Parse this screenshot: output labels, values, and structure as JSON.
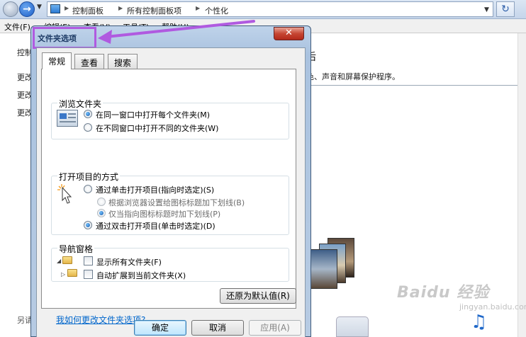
{
  "explorer": {
    "breadcrumbs": [
      "控制面板",
      "所有控制面板项",
      "个性化"
    ],
    "menu": [
      "文件(F)",
      "编辑(E)",
      "查看(V)",
      "工具(T)",
      "帮助(H)"
    ],
    "sidebar": {
      "home": "控制",
      "items": [
        "更改",
        "更改",
        "更改"
      ],
      "see_also": "另请"
    },
    "content_desc": "色、声音和屏幕保护程序。",
    "content_title": "后"
  },
  "dialog": {
    "title": "文件夹选项",
    "close_glyph": "✕",
    "tabs": [
      "常规",
      "查看",
      "搜索"
    ],
    "browse_group": {
      "title": "浏览文件夹",
      "options": [
        "在同一窗口中打开每个文件夹(M)",
        "在不同窗口中打开不同的文件夹(W)"
      ],
      "selected_index": 0
    },
    "click_group": {
      "title": "打开项目的方式",
      "single_click": "通过单击打开项目(指向时选定)(S)",
      "underline_browser": "根据浏览器设置给图标标题加下划线(B)",
      "underline_hover": "仅当指向图标标题时加下划线(P)",
      "double_click": "通过双击打开项目(单击时选定)(D)"
    },
    "nav_group": {
      "title": "导航窗格",
      "show_all": "显示所有文件夹(F)",
      "auto_expand": "自动扩展到当前文件夹(X)"
    },
    "restore_defaults": "还原为默认值(R)",
    "help_link": "我如何更改文件夹选项?",
    "ok": "确定",
    "cancel": "取消",
    "apply": "应用(A)"
  },
  "watermark": {
    "main": "Baidu 经验",
    "sub": "jingyan.baidu.com"
  },
  "colors": {
    "annotation": "#b05ae0",
    "link": "#0066cc",
    "close_button": "#c64633"
  }
}
